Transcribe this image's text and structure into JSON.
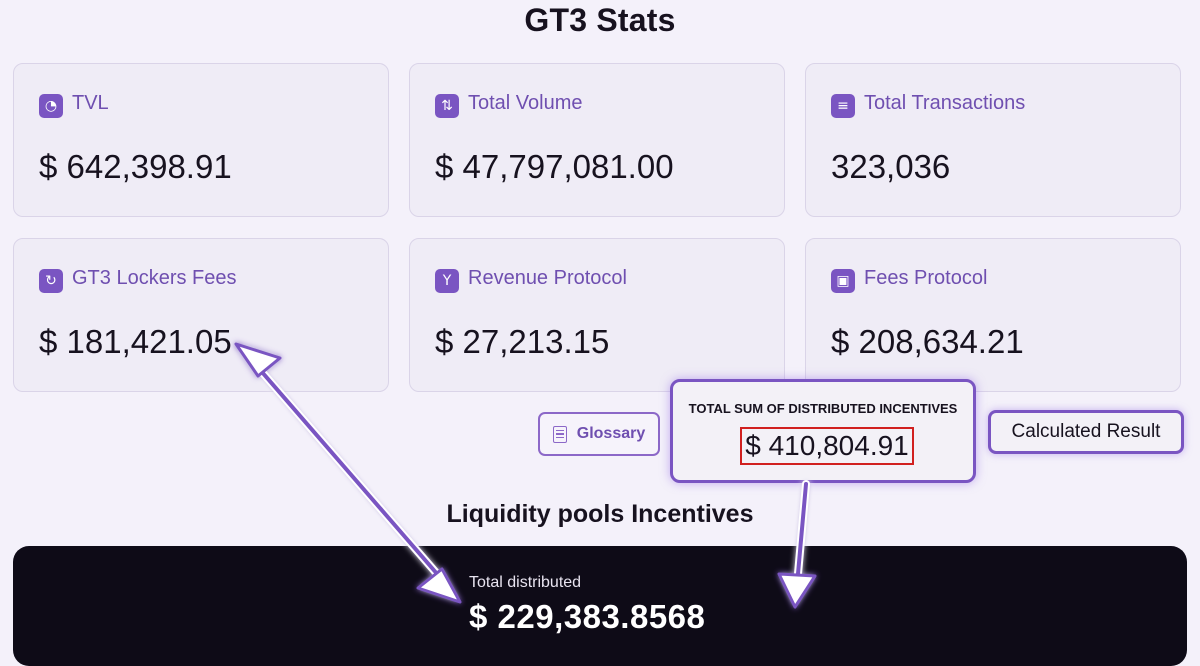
{
  "page": {
    "title": "GT3 Stats"
  },
  "stats": [
    {
      "label": "TVL",
      "value": "$ 642,398.91",
      "icon": "gauge-icon"
    },
    {
      "label": "Total Volume",
      "value": "$ 47,797,081.00",
      "icon": "arrows-up-down-icon"
    },
    {
      "label": "Total Transactions",
      "value": "323,036",
      "icon": "scroll-icon"
    },
    {
      "label": "GT3 Lockers Fees",
      "value": "$ 181,421.05",
      "icon": "refresh-coin-icon"
    },
    {
      "label": "Revenue Protocol",
      "value": "$ 27,213.15",
      "icon": "split-arrow-icon"
    },
    {
      "label": "Fees Protocol",
      "value": "$ 208,634.21",
      "icon": "wallet-icon"
    }
  ],
  "glossary": {
    "label": "Glossary",
    "icon": "document-icon"
  },
  "callout": {
    "heading": "TOTAL SUM OF DISTRIBUTED INCENTIVES",
    "value": "$ 410,804.91"
  },
  "calculated_result": {
    "label": "Calculated Result"
  },
  "incentives": {
    "heading": "Liquidity pools Incentives",
    "caption": "Total distributed",
    "value": "$ 229,383.8568"
  },
  "colors": {
    "accent": "#7a55c2",
    "label_purple": "#6f4fb0",
    "highlight_red": "#d1201f",
    "dark_panel": "#0e0b17",
    "page_background": "#f4f1fa"
  }
}
